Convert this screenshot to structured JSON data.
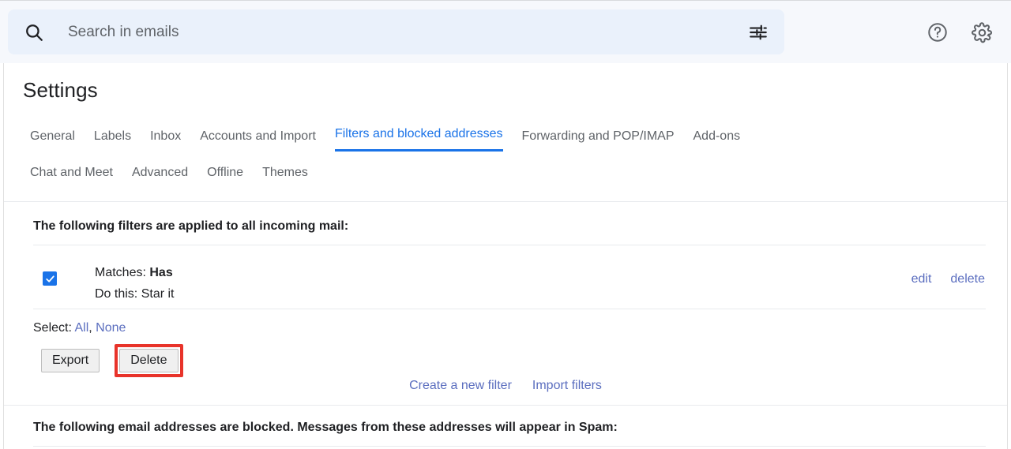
{
  "search": {
    "placeholder": "Search in emails",
    "value": "",
    "search_icon": "search-icon",
    "tune_icon": "tune-filter-icon"
  },
  "header": {
    "help_icon": "help-circle-icon",
    "settings_icon": "gear-icon"
  },
  "page": {
    "title": "Settings"
  },
  "tabs": {
    "row1": [
      {
        "label": "General",
        "active": false
      },
      {
        "label": "Labels",
        "active": false
      },
      {
        "label": "Inbox",
        "active": false
      },
      {
        "label": "Accounts and Import",
        "active": false
      },
      {
        "label": "Filters and blocked addresses",
        "active": true
      },
      {
        "label": "Forwarding and POP/IMAP",
        "active": false
      },
      {
        "label": "Add-ons",
        "active": false
      }
    ],
    "row2": [
      {
        "label": "Chat and Meet",
        "active": false
      },
      {
        "label": "Advanced",
        "active": false
      },
      {
        "label": "Offline",
        "active": false
      },
      {
        "label": "Themes",
        "active": false
      }
    ]
  },
  "filters_section": {
    "heading": "The following filters are applied to all incoming mail:",
    "rows": [
      {
        "checked": true,
        "match_label": "Matches:",
        "match_value": "Has",
        "action_label": "Do this:",
        "action_value": "Star it",
        "edit_label": "edit",
        "delete_label": "delete"
      }
    ],
    "select_label": "Select:",
    "select_all_label": "All",
    "select_separator": ",",
    "select_none_label": "None",
    "export_button": "Export",
    "delete_button": "Delete",
    "highlight_color": "#e8332a"
  },
  "footer_links": {
    "create_filter": "Create a new filter",
    "import_filters": "Import filters"
  },
  "blocked_section": {
    "heading": "The following email addresses are blocked. Messages from these addresses will appear in Spam:"
  },
  "colors": {
    "accent": "#1a73e8",
    "link": "#5b6ebf",
    "header_bg": "#f6f8fc",
    "search_bg": "#eaf1fb"
  }
}
